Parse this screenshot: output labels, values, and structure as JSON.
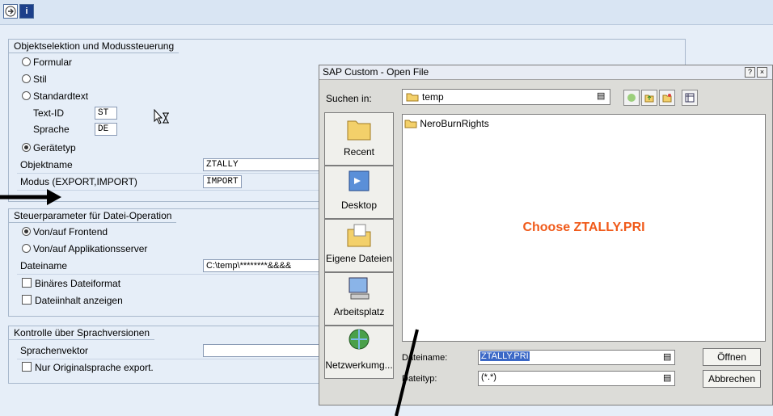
{
  "toolbar": {
    "execute_icon": "execute-icon",
    "info_icon": "info-icon"
  },
  "group1": {
    "title": "Objektselektion und Modussteuerung",
    "radio_formular": "Formular",
    "radio_stil": "Stil",
    "radio_standardtext": "Standardtext",
    "textid_label": "Text-ID",
    "textid_value": "ST",
    "sprache_label": "Sprache",
    "sprache_value": "DE",
    "radio_geraetetyp": "Gerätetyp",
    "objektname_label": "Objektname",
    "objektname_value": "ZTALLY",
    "modus_label": "Modus (EXPORT,IMPORT)",
    "modus_value": "IMPORT"
  },
  "group2": {
    "title": "Steuerparameter für Datei-Operation",
    "radio_frontend": "Von/auf Frontend",
    "radio_appserver": "Von/auf Applikationsserver",
    "dateiname_label": "Dateiname",
    "dateiname_value": "C:\\temp\\********&&&&",
    "check_binaer": "Binäres Dateiformat",
    "check_inhalt": "Dateiinhalt anzeigen"
  },
  "group3": {
    "title": "Kontrolle über Sprachversionen",
    "sprachenvektor_label": "Sprachenvektor",
    "sprachenvektor_value": "",
    "check_original": "Nur Originalsprache export."
  },
  "dialog": {
    "title": "SAP Custom - Open File",
    "help_btn": "?",
    "close_btn": "×",
    "lookin_label": "Suchen in:",
    "lookin_value": "temp",
    "places": [
      "Recent",
      "Desktop",
      "Eigene Dateien",
      "Arbeitsplatz",
      "Netzwerkumg..."
    ],
    "file_item": "NeroBurnRights",
    "filename_label": "Dateiname:",
    "filename_value": "ZTALLY.PRI",
    "filetype_label": "Dateityp:",
    "filetype_value": "(*.*)",
    "open_btn": "Öffnen",
    "cancel_btn": "Abbrechen"
  },
  "annotation": {
    "text": "Choose ZTALLY.PRI",
    "color": "#f05a1a"
  }
}
